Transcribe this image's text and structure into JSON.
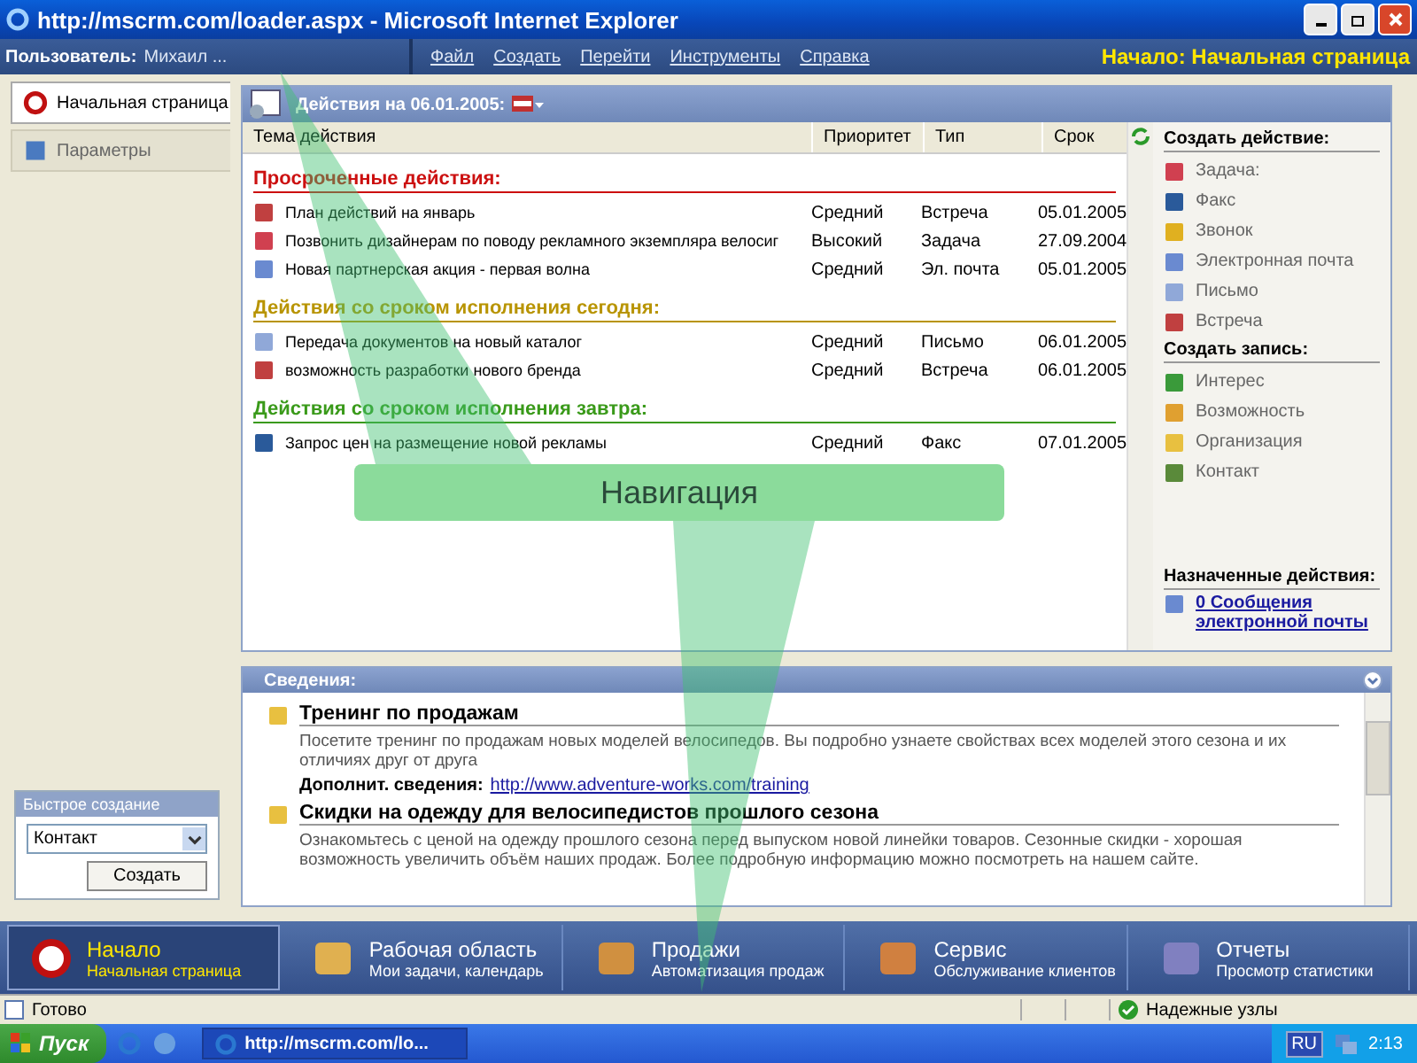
{
  "window": {
    "title": "http://mscrm.com/loader.aspx - Microsoft Internet Explorer"
  },
  "top_bar": {
    "user_label": "Пользователь:",
    "user_name": "Михаил ...",
    "menu": [
      "Файл",
      "Создать",
      "Перейти",
      "Инструменты",
      "Справка"
    ],
    "location": "Начало: Начальная страница"
  },
  "sidebar": {
    "items": [
      {
        "label": "Начальная страница",
        "selected": true,
        "kind": "home"
      },
      {
        "label": "Параметры",
        "selected": false,
        "kind": "settings"
      }
    ],
    "quick_create": {
      "title": "Быстрое создание",
      "value": "Контакт",
      "button": "Создать"
    }
  },
  "actions": {
    "title": "Действия на 06.01.2005:",
    "columns": [
      "Тема действия",
      "Приоритет",
      "Тип",
      "Срок"
    ],
    "groups": [
      {
        "title": "Просроченные действия:",
        "color": "#cc1010",
        "rows": [
          {
            "kind": "meeting",
            "subject": "План действий на январь",
            "priority": "Средний",
            "type": "Встреча",
            "due": "05.01.2005"
          },
          {
            "kind": "task",
            "subject": "Позвонить дизайнерам по поводу рекламного экземпляра велосиг",
            "priority": "Высокий",
            "type": "Задача",
            "due": "27.09.2004"
          },
          {
            "kind": "email",
            "subject": "Новая партнерская акция - первая волна",
            "priority": "Средний",
            "type": "Эл. почта",
            "due": "05.01.2005"
          }
        ]
      },
      {
        "title": "Действия со сроком исполнения сегодня:",
        "color": "#b89400",
        "rows": [
          {
            "kind": "letter",
            "subject": "Передача документов на новый каталог",
            "priority": "Средний",
            "type": "Письмо",
            "due": "06.01.2005"
          },
          {
            "kind": "meeting",
            "subject": "возможность разработки нового бренда",
            "priority": "Средний",
            "type": "Встреча",
            "due": "06.01.2005"
          }
        ]
      },
      {
        "title": "Действия со сроком исполнения завтра:",
        "color": "#3a9a1a",
        "rows": [
          {
            "kind": "fax",
            "subject": "Запрос цен на размещение новой рекламы",
            "priority": "Средний",
            "type": "Факс",
            "due": "07.01.2005"
          }
        ]
      }
    ]
  },
  "create_action": {
    "title": "Создать действие:",
    "items": [
      {
        "kind": "task",
        "label": "Задача:"
      },
      {
        "kind": "fax",
        "label": "Факс"
      },
      {
        "kind": "call",
        "label": "Звонок"
      },
      {
        "kind": "email",
        "label": "Электронная почта"
      },
      {
        "kind": "letter",
        "label": "Письмо"
      },
      {
        "kind": "meeting",
        "label": "Встреча"
      }
    ]
  },
  "create_record": {
    "title": "Создать запись:",
    "items": [
      {
        "kind": "lead",
        "label": "Интерес"
      },
      {
        "kind": "opportunity",
        "label": "Возможность"
      },
      {
        "kind": "organization",
        "label": "Организация"
      },
      {
        "kind": "contact",
        "label": "Контакт"
      }
    ]
  },
  "assigned": {
    "title": "Назначенные действия:",
    "link": "0 Сообщения электронной почты"
  },
  "info": {
    "title": "Сведения:",
    "articles": [
      {
        "title": "Тренинг по продажам",
        "text": "Посетите тренинг по продажам новых моделей велосипедов. Вы подробно узнаете свойствах всех моделей этого сезона и их отличиях друг от друга",
        "more_label": "Дополнит. сведения:",
        "url": "http://www.adventure-works.com/training"
      },
      {
        "title": "Скидки на одежду для велосипедистов прошлого сезона",
        "text": "Ознакомьтесь с ценой на одежду прошлого сезона перед выпуском новой линейки товаров. Сезонные скидки - хорошая возможность увеличить объём наших продаж. Более подробную информацию можно посмотреть на нашем сайте."
      }
    ]
  },
  "nav_tabs": [
    {
      "kind": "home",
      "title": "Начало",
      "subtitle": "Начальная страница",
      "selected": true
    },
    {
      "kind": "workplace",
      "title": "Рабочая область",
      "subtitle": "Мои задачи, календарь",
      "selected": false
    },
    {
      "kind": "sales",
      "title": "Продажи",
      "subtitle": "Автоматизация продаж",
      "selected": false
    },
    {
      "kind": "service",
      "title": "Сервис",
      "subtitle": "Обслуживание клиентов",
      "selected": false
    },
    {
      "kind": "reports",
      "title": "Отчеты",
      "subtitle": "Просмотр статистики",
      "selected": false
    }
  ],
  "status_bar": {
    "text": "Готово",
    "zone": "Надежные узлы"
  },
  "taskbar": {
    "start": "Пуск",
    "task": "http://mscrm.com/lo...",
    "lang": "RU",
    "time": "2:13"
  },
  "callout": {
    "text": "Навигация"
  }
}
